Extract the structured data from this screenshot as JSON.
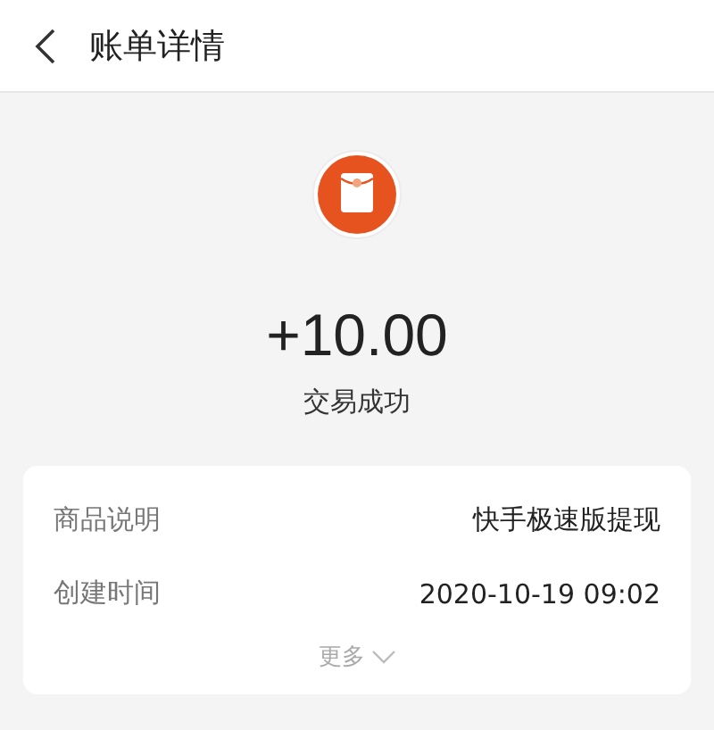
{
  "header": {
    "title": "账单详情"
  },
  "summary": {
    "amount": "+10.00",
    "status": "交易成功"
  },
  "details": [
    {
      "label": "商品说明",
      "value": "快手极速版提现"
    },
    {
      "label": "创建时间",
      "value": "2020-10-19 09:02"
    }
  ],
  "more": {
    "label": "更多",
    "expanded": false
  }
}
